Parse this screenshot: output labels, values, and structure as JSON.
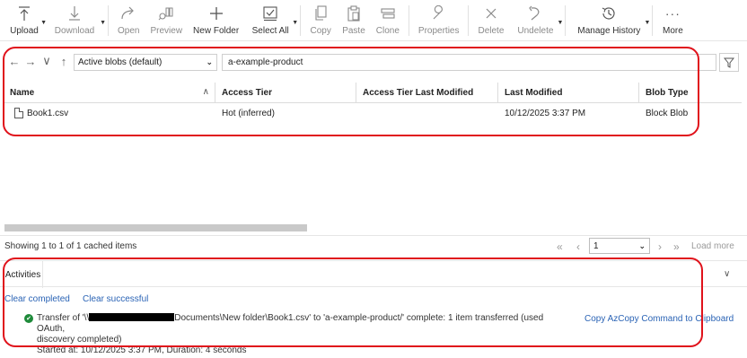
{
  "toolbar": {
    "upload": "Upload",
    "download": "Download",
    "open": "Open",
    "preview": "Preview",
    "new_folder": "New Folder",
    "select_all": "Select All",
    "copy": "Copy",
    "paste": "Paste",
    "clone": "Clone",
    "properties": "Properties",
    "delete": "Delete",
    "undelete": "Undelete",
    "manage_history": "Manage History",
    "more": "More"
  },
  "address": {
    "view_select": "Active blobs (default)",
    "path": "a-example-product"
  },
  "table": {
    "headers": [
      "Name",
      "Access Tier",
      "Access Tier Last Modified",
      "Last Modified",
      "Blob Type"
    ],
    "rows": [
      {
        "name": "Book1.csv",
        "access_tier": "Hot (inferred)",
        "access_tier_last_modified": "",
        "last_modified": "10/12/2025 3:37 PM",
        "blob_type": "Block Blob"
      }
    ]
  },
  "status": {
    "text": "Showing 1 to 1 of 1 cached items",
    "page": "1",
    "load_more": "Load more"
  },
  "activities": {
    "tab": "Activities",
    "clear_completed": "Clear completed",
    "clear_successful": "Clear successful",
    "entry_prefix": "Transfer of '\\\\",
    "entry_suffix": "Documents\\New folder\\Book1.csv' to 'a-example-product/' complete: 1 item transferred (used OAuth,",
    "entry_line2": "discovery completed)",
    "entry_line3": "Started at: 10/12/2025 3:37 PM, Duration: 4 seconds",
    "copy_command": "Copy AzCopy Command to Clipboard"
  },
  "colors": {
    "highlight": "#e0121b",
    "link": "#2a63b5",
    "success": "#1e8a3a"
  }
}
